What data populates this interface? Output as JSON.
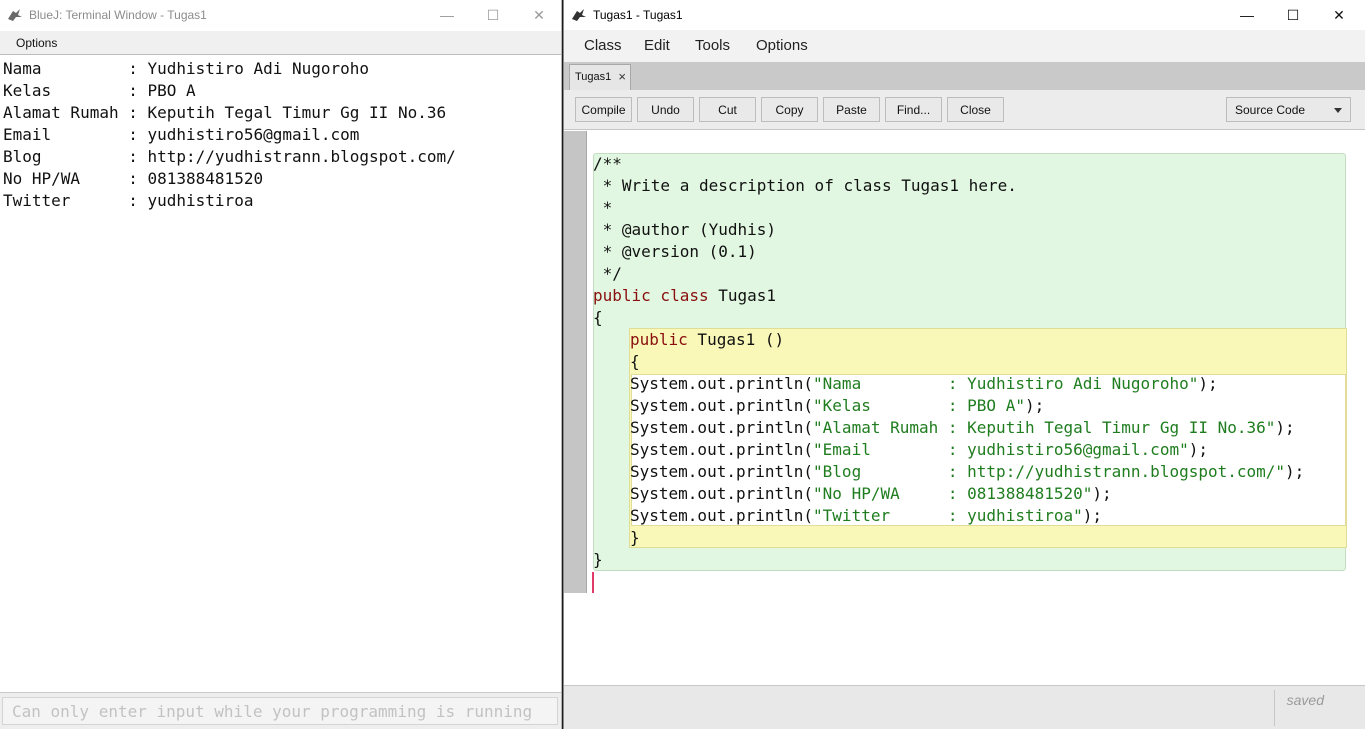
{
  "terminal": {
    "title": "BlueJ: Terminal Window - Tugas1",
    "menu": [
      "Options"
    ],
    "output_lines": [
      "Nama         : Yudhistiro Adi Nugoroho",
      "Kelas        : PBO A",
      "Alamat Rumah : Keputih Tegal Timur Gg II No.36",
      "Email        : yudhistiro56@gmail.com",
      "Blog         : http://yudhistrann.blogspot.com/",
      "No HP/WA     : 081388481520",
      "Twitter      : yudhistiroa"
    ],
    "input_placeholder": "Can only enter input while your programming is running"
  },
  "editor": {
    "title": "Tugas1 - Tugas1",
    "menu": [
      "Class",
      "Edit",
      "Tools",
      "Options"
    ],
    "tab": {
      "label": "Tugas1",
      "close": "×"
    },
    "toolbar": {
      "buttons": [
        "Compile",
        "Undo",
        "Cut",
        "Copy",
        "Paste",
        "Find...",
        "Close"
      ],
      "view_select": "Source Code"
    },
    "code": {
      "comment": [
        "/**",
        " * Write a description of class Tugas1 here.",
        " *",
        " * @author (Yudhis)",
        " * @version (0.1)",
        " */"
      ],
      "class_kw": "public class",
      "class_name": " Tugas1",
      "open_brace": "{",
      "ctor_kw": "public",
      "ctor_sig": " Tugas1 ()",
      "ctor_open": "{",
      "call": "System.out.println(",
      "strings": [
        "\"Nama         : Yudhistiro Adi Nugoroho\"",
        "\"Kelas        : PBO A\"",
        "\"Alamat Rumah : Keputih Tegal Timur Gg II No.36\"",
        "\"Email        : yudhistiro56@gmail.com\"",
        "\"Blog         : http://yudhistrann.blogspot.com/\"",
        "\"No HP/WA     : 081388481520\"",
        "\"Twitter      : yudhistiroa\""
      ],
      "call_end": ");",
      "ctor_close": "}",
      "class_close": "}"
    },
    "status": "saved"
  },
  "icons": {
    "window_minimize": "minimize-icon",
    "window_maximize": "maximize-icon",
    "window_close": "close-icon",
    "app": "bluej-bird-icon"
  },
  "colors": {
    "class_scope": "#e1f7e1",
    "method_scope": "#f9f8b9",
    "comment": "#1a1aa6",
    "keyword": "#8a0f0f",
    "string": "#1f7d1f"
  }
}
